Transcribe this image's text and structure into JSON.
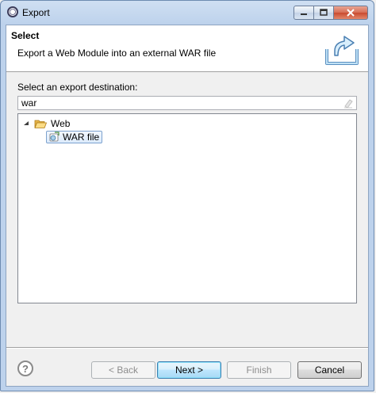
{
  "window": {
    "title": "Export"
  },
  "header": {
    "title": "Select",
    "description": "Export a Web Module into an external WAR file"
  },
  "destination": {
    "label": "Select an export destination:",
    "filter_value": "war"
  },
  "tree": {
    "folder_label": "Web",
    "item_label": "WAR file"
  },
  "buttons": {
    "back": "< Back",
    "next": "Next >",
    "finish": "Finish",
    "cancel": "Cancel",
    "help": "?"
  }
}
